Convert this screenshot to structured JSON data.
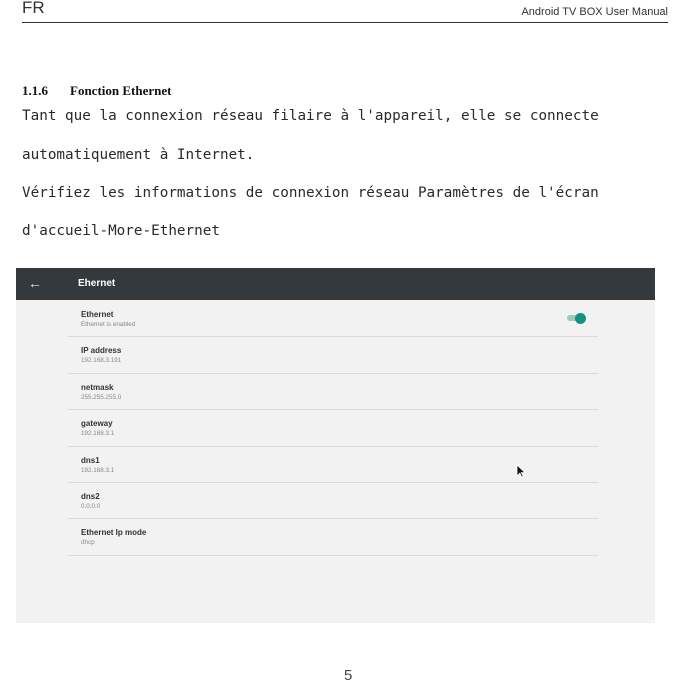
{
  "header": {
    "left": "FR",
    "right": "Android TV BOX User Manual"
  },
  "section": {
    "number": "1.1.6",
    "title": "Fonction Ethernet"
  },
  "body": {
    "lines": [
      "Tant que la connexion réseau filaire à l'appareil, elle se connecte",
      "automatiquement à Internet.",
      "Vérifiez les informations de connexion réseau Paramètres de l'écran",
      "d'accueil-More-Ethernet"
    ]
  },
  "screenshot": {
    "appbar": {
      "back_icon": "arrow-left-icon",
      "title": "Ehernet"
    },
    "rows": [
      {
        "title": "Ethernet",
        "subtitle": "Ethernet is enabled",
        "toggle": true
      },
      {
        "title": "IP address",
        "subtitle": "192.168.3.191"
      },
      {
        "title": "netmask",
        "subtitle": "255.255.255.0"
      },
      {
        "title": "gateway",
        "subtitle": "192.168.3.1"
      },
      {
        "title": "dns1",
        "subtitle": "192.168.3.1"
      },
      {
        "title": "dns2",
        "subtitle": "0.0.0.0"
      },
      {
        "title": "Ethernet Ip mode",
        "subtitle": "dhcp"
      }
    ],
    "toggle_color": "#14927f",
    "appbar_color": "#33393d"
  },
  "footer": {
    "page_number": "5"
  }
}
